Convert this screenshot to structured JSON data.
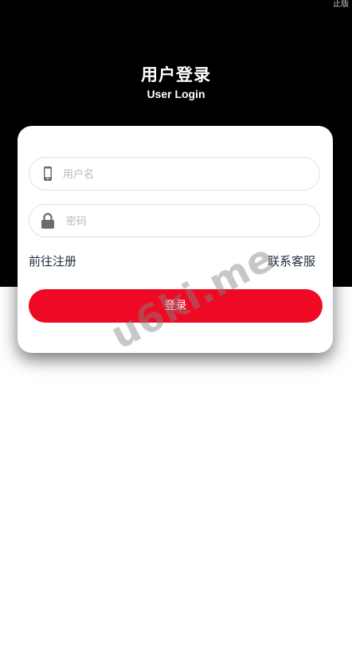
{
  "corner_text": "止版",
  "header": {
    "title": "用户登录",
    "subtitle": "User Login"
  },
  "form": {
    "username": {
      "placeholder": "用户名",
      "value": "",
      "icon": "phone-icon"
    },
    "password": {
      "placeholder": "密码",
      "value": "",
      "icon": "lock-icon"
    },
    "register_link": "前往注册",
    "support_link": "联系客服",
    "login_button": "登录"
  },
  "watermark": "u6ki.me",
  "colors": {
    "header_bg": "#000000",
    "accent": "#ee0a24",
    "link_text": "#222f3e",
    "card_bg": "#ffffff"
  }
}
